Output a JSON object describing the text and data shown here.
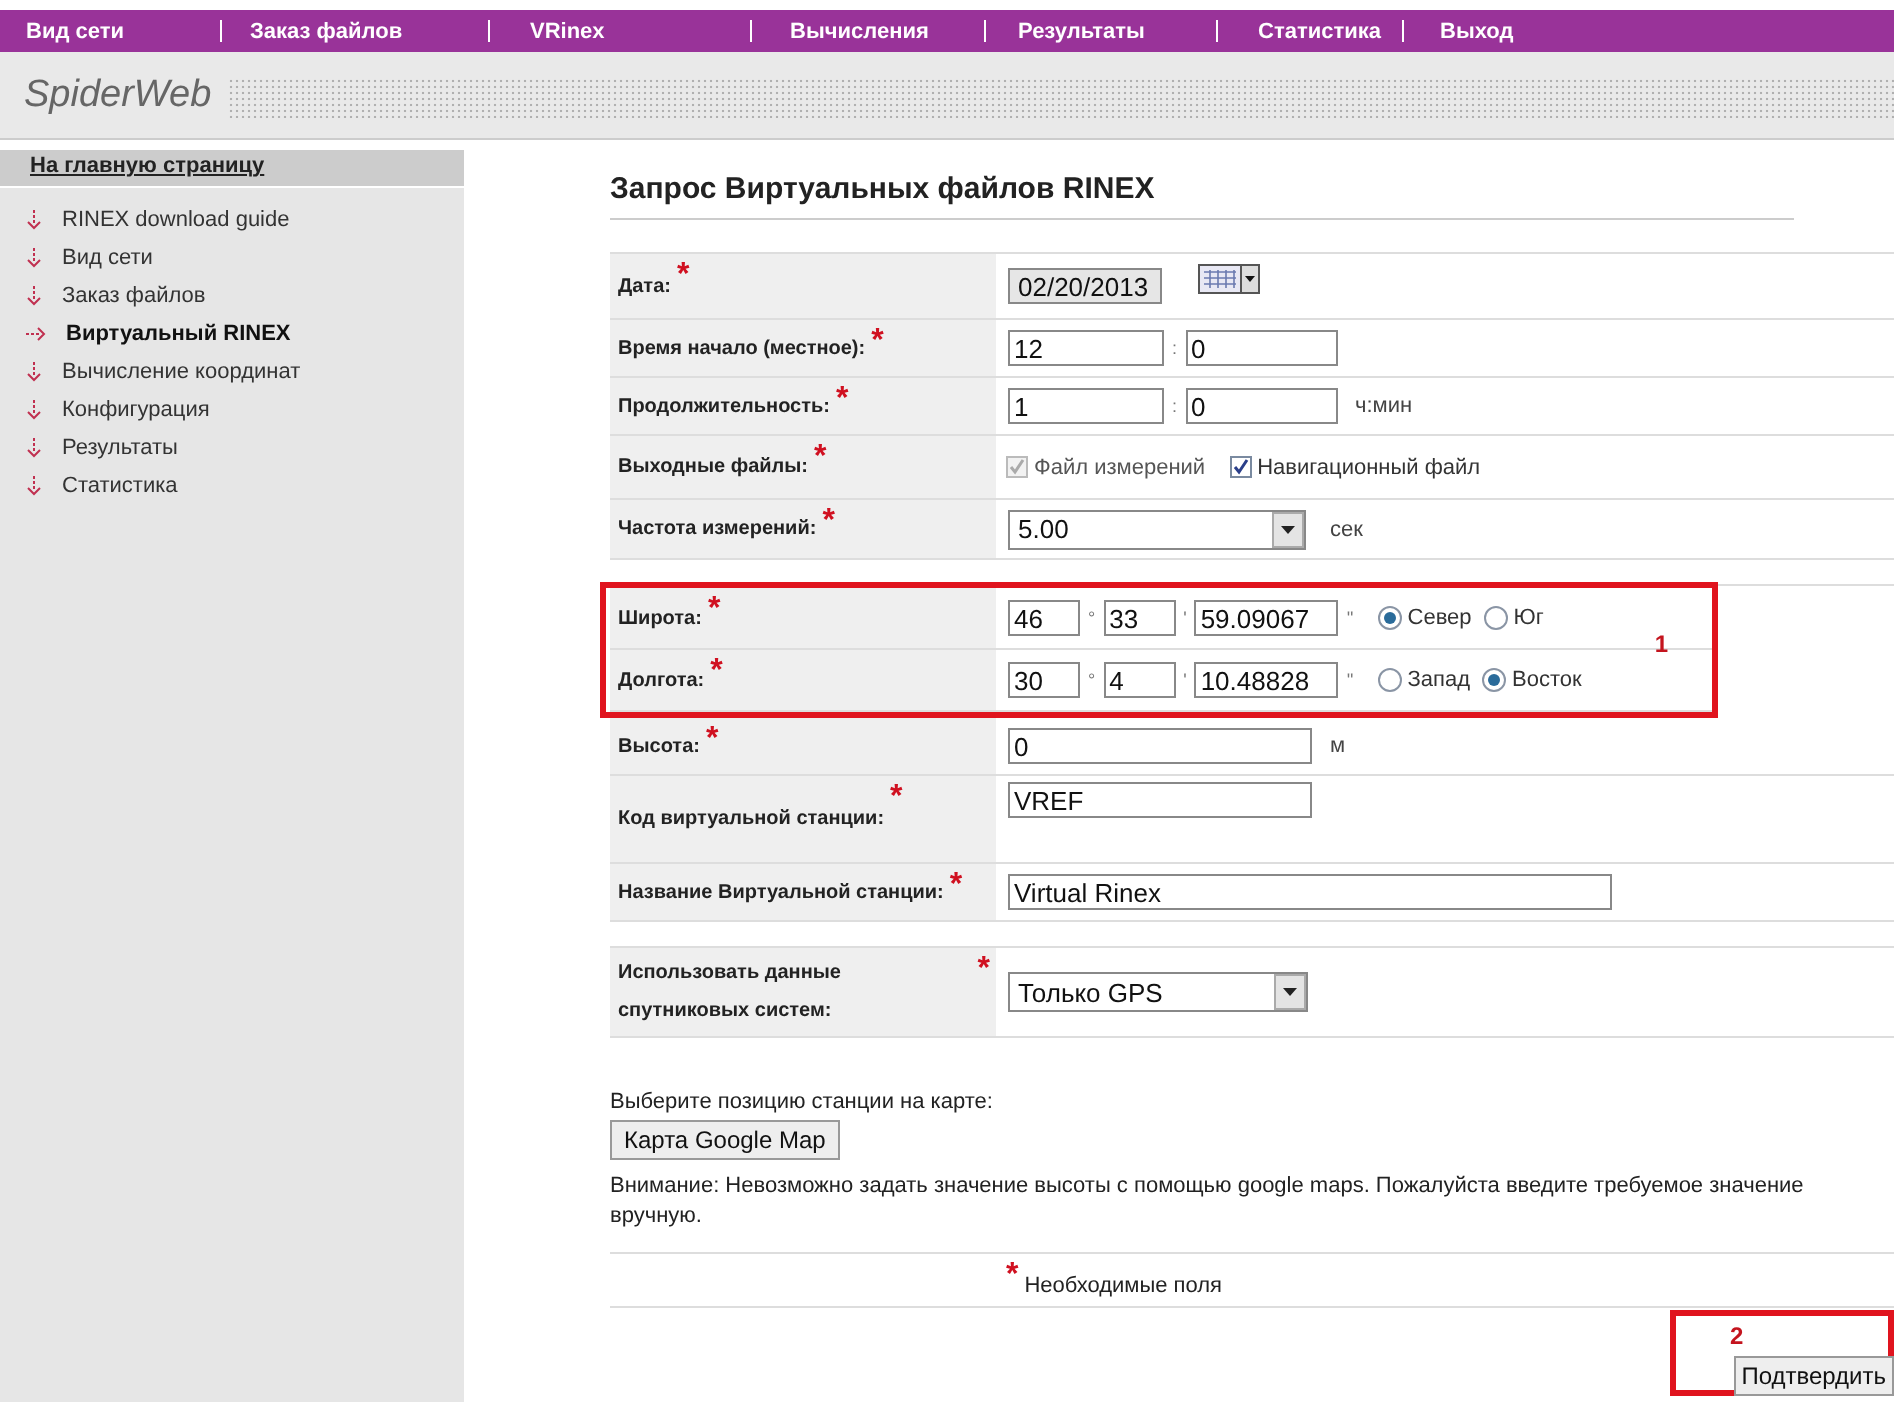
{
  "nav": [
    "Вид сети",
    "Заказ файлов",
    "VRinex",
    "Вычисления",
    "Результаты",
    "Статистика",
    "Выход"
  ],
  "logo": "SpiderWeb",
  "sidebar": {
    "home": "На главную страницу",
    "items": [
      {
        "label": "RINEX download guide",
        "selected": false
      },
      {
        "label": "Вид сети",
        "selected": false
      },
      {
        "label": "Заказ файлов",
        "selected": false
      },
      {
        "label": "Виртуальный RINEX",
        "selected": true
      },
      {
        "label": "Вычисление координат",
        "selected": false
      },
      {
        "label": "Конфигурация",
        "selected": false
      },
      {
        "label": "Результаты",
        "selected": false
      },
      {
        "label": "Статистика",
        "selected": false
      }
    ]
  },
  "form": {
    "title": "Запрос Виртуальных файлов RINEX",
    "required_mark": "*",
    "groups": [
      {
        "parts": [
          {
            "rows": [
              {
                "kind": "date",
                "label": "Дата:",
                "required": true,
                "value": "02/20/2013"
              },
              {
                "kind": "pair",
                "label": "Время начало (местное):",
                "required": true,
                "values": [
                  "12",
                  "0"
                ],
                "separator": ":"
              },
              {
                "kind": "pair",
                "label": "Продолжительность:",
                "required": true,
                "values": [
                  "1",
                  "0"
                ],
                "separator": ":",
                "unit": "ч:мин"
              },
              {
                "kind": "checks",
                "label": "Выходные файлы:",
                "required": true,
                "options": [
                  {
                    "label": "Файл измерений",
                    "checked": true,
                    "disabled": true
                  },
                  {
                    "label": "Навигационный файл",
                    "checked": true,
                    "disabled": false
                  }
                ]
              },
              {
                "kind": "select",
                "label": "Частота измерений:",
                "required": true,
                "value": "5.00",
                "unit": "сек"
              }
            ]
          }
        ]
      },
      {
        "parts": [
          {
            "annotation": "1",
            "rows": [
              {
                "kind": "coord",
                "label": "Широта:",
                "required": true,
                "values": [
                  "46",
                  "33",
                  "59.09067"
                ],
                "separators": [
                  "°",
                  "'",
                  "''"
                ],
                "options": [
                  {
                    "label": "Север",
                    "selected": true
                  },
                  {
                    "label": "Юг",
                    "selected": false
                  }
                ]
              },
              {
                "kind": "coord",
                "label": "Долгота:",
                "required": true,
                "values": [
                  "30",
                  "4",
                  "10.48828"
                ],
                "separators": [
                  "°",
                  "'",
                  "''"
                ],
                "options": [
                  {
                    "label": "Запад",
                    "selected": false
                  },
                  {
                    "label": "Восток",
                    "selected": true
                  }
                ]
              }
            ]
          },
          {
            "rows": [
              {
                "kind": "text",
                "label": "Высота:",
                "required": true,
                "value": "0",
                "unit": "м"
              },
              {
                "kind": "text",
                "label": "Код виртуальной станции:",
                "required": true,
                "value": "VREF"
              },
              {
                "kind": "wide",
                "label": "Название Виртуальной станции:",
                "required": true,
                "value": "Virtual Rinex"
              }
            ]
          }
        ]
      },
      {
        "parts": [
          {
            "rows": [
              {
                "kind": "select",
                "label": "Использовать данные спутниковых систем:",
                "required": true,
                "value": "Только GPS"
              }
            ]
          }
        ]
      }
    ]
  },
  "footer": {
    "map_hint": "Выберите позицию станции на карте:",
    "map_button": "Карта Google Map",
    "warning": "Внимание: Невозможно задать значение высоты с помощью google maps. Пожалуйста введите требуемое значение вручную.",
    "required_note": "Необходимые поля",
    "submit": {
      "label": "Подтвердить",
      "annotation": "2"
    }
  }
}
